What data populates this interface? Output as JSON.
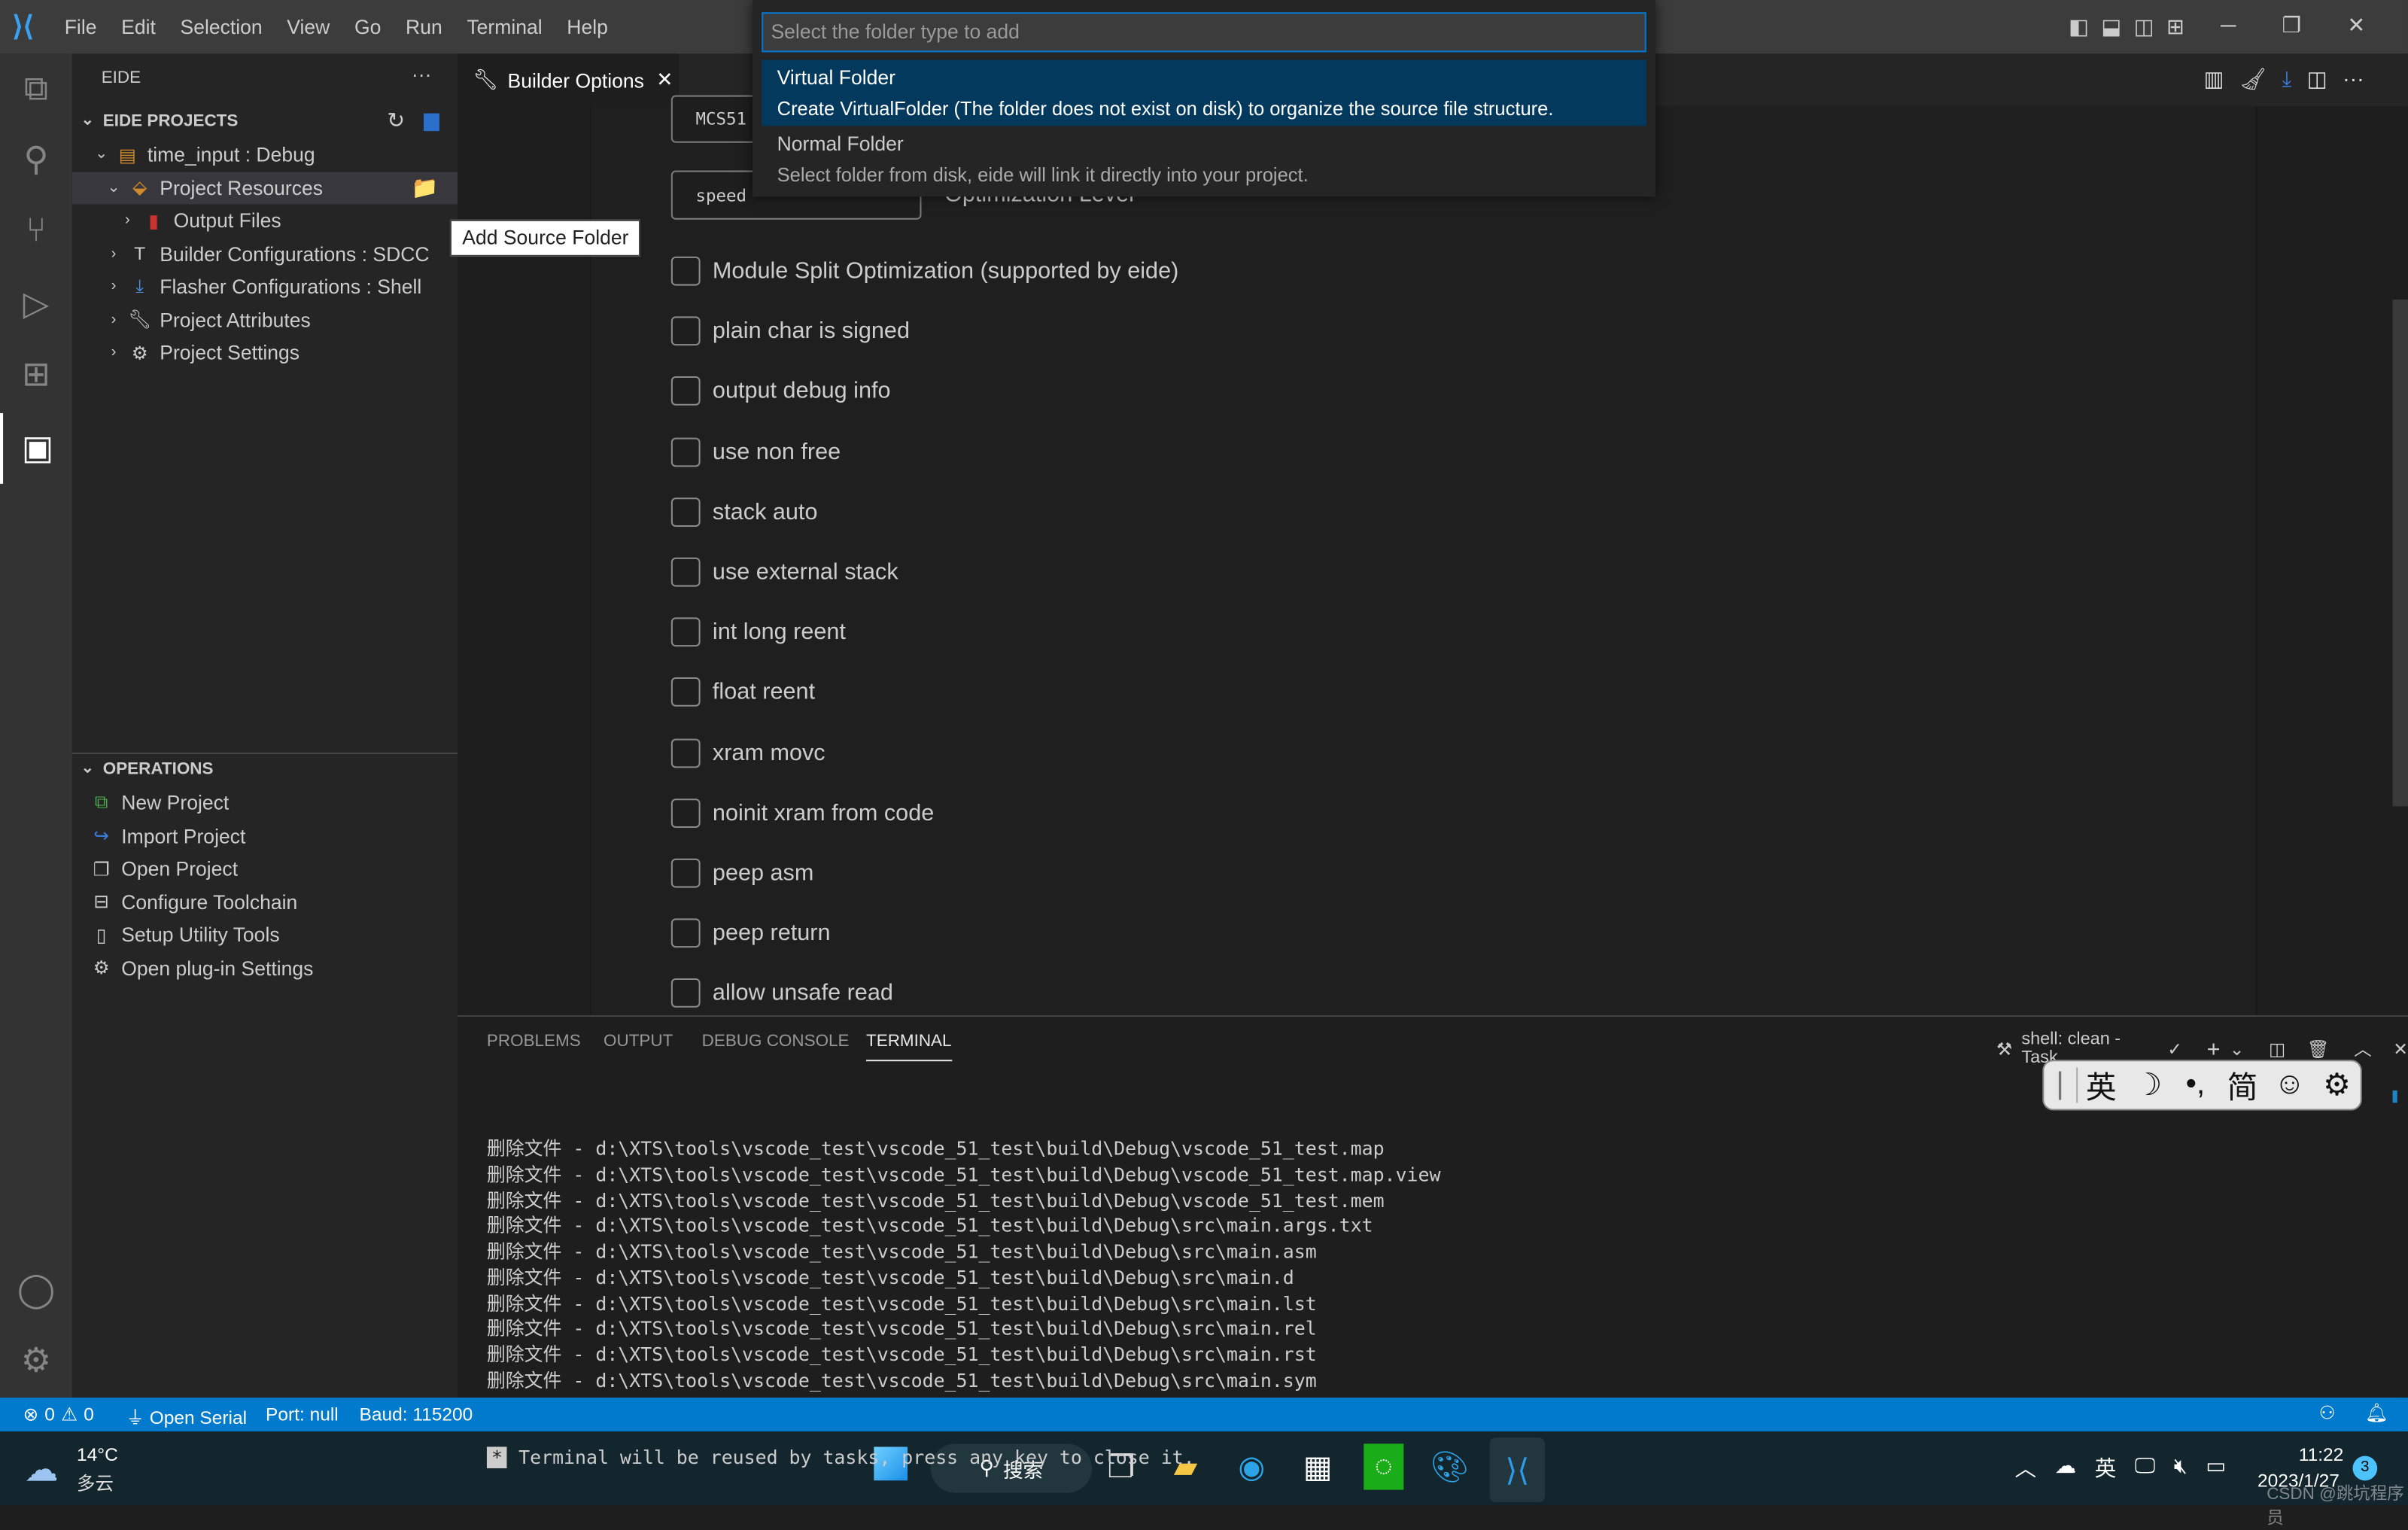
{
  "menu": [
    "File",
    "Edit",
    "Selection",
    "View",
    "Go",
    "Run",
    "Terminal",
    "Help"
  ],
  "sidebar": {
    "title": "EIDE",
    "more": "···",
    "projects_header": "EIDE PROJECTS",
    "tree": [
      {
        "label": "time_input : Debug",
        "icon": "project-icon"
      },
      {
        "label": "Project Resources",
        "icon": "resources-icon"
      },
      {
        "label": "Output Files",
        "icon": "binary-file-icon"
      },
      {
        "label": "Builder Configurations : SDCC",
        "icon": "hammer-icon"
      },
      {
        "label": "Flasher Configurations : Shell",
        "icon": "download-icon"
      },
      {
        "label": "Project Attributes",
        "icon": "wrench-icon"
      },
      {
        "label": "Project Settings",
        "icon": "gear-icon"
      }
    ],
    "operations_header": "OPERATIONS",
    "operations": [
      "New Project",
      "Import Project",
      "Open Project",
      "Configure Toolchain",
      "Setup Utility Tools",
      "Open plug-in Settings"
    ]
  },
  "tooltip": "Add Source Folder",
  "editor": {
    "tab_label": "Builder Options",
    "cpu_select": "MCS51",
    "opt_select": "speed",
    "opt_label": "Optimization Level",
    "checkboxes": [
      {
        "label": "Module Split Optimization (supported by eide)",
        "checked": false
      },
      {
        "label": "plain char is signed",
        "checked": false
      },
      {
        "label": "output debug info",
        "checked": false
      },
      {
        "label": "use non free",
        "checked": false
      },
      {
        "label": "stack auto",
        "checked": false
      },
      {
        "label": "use external stack",
        "checked": false
      },
      {
        "label": "int long reent",
        "checked": false
      },
      {
        "label": "float reent",
        "checked": false
      },
      {
        "label": "xram movc",
        "checked": false
      },
      {
        "label": "noinit xram from code",
        "checked": false
      },
      {
        "label": "peep asm",
        "checked": false
      },
      {
        "label": "peep return",
        "checked": false
      },
      {
        "label": "allow unsafe read",
        "checked": false
      }
    ]
  },
  "quickpick": {
    "placeholder": "Select the folder type to add",
    "items": [
      {
        "label": "Virtual Folder",
        "detail": "Create VirtualFolder (The folder does not exist on disk) to organize the source file structure."
      },
      {
        "label": "Normal Folder",
        "detail": "Select folder from disk, eide will link it directly into your project."
      }
    ]
  },
  "panel": {
    "tabs": [
      "PROBLEMS",
      "OUTPUT",
      "DEBUG CONSOLE",
      "TERMINAL"
    ],
    "active_tab": "TERMINAL",
    "terminal_name": "shell: clean - Task",
    "lines": [
      "删除文件 - d:\\XTS\\tools\\vscode_test\\vscode_51_test\\build\\Debug\\vscode_51_test.map",
      "删除文件 - d:\\XTS\\tools\\vscode_test\\vscode_51_test\\build\\Debug\\vscode_51_test.map.view",
      "删除文件 - d:\\XTS\\tools\\vscode_test\\vscode_51_test\\build\\Debug\\vscode_51_test.mem",
      "删除文件 - d:\\XTS\\tools\\vscode_test\\vscode_51_test\\build\\Debug\\src\\main.args.txt",
      "删除文件 - d:\\XTS\\tools\\vscode_test\\vscode_51_test\\build\\Debug\\src\\main.asm",
      "删除文件 - d:\\XTS\\tools\\vscode_test\\vscode_51_test\\build\\Debug\\src\\main.d",
      "删除文件 - d:\\XTS\\tools\\vscode_test\\vscode_51_test\\build\\Debug\\src\\main.lst",
      "删除文件 - d:\\XTS\\tools\\vscode_test\\vscode_51_test\\build\\Debug\\src\\main.rel",
      "删除文件 - d:\\XTS\\tools\\vscode_test\\vscode_51_test\\build\\Debug\\src\\main.rst",
      "删除文件 - d:\\XTS\\tools\\vscode_test\\vscode_51_test\\build\\Debug\\src\\main.sym"
    ],
    "star": "*",
    "last_line": "Terminal will be reused by tasks, press any key to close it."
  },
  "ime": [
    "英",
    "☽",
    "•,",
    "简",
    "☺",
    "⚙"
  ],
  "status": {
    "errors": "0",
    "warnings": "0",
    "serial": "Open Serial",
    "port": "Port: null",
    "baud": "Baud: 115200"
  },
  "taskbar": {
    "weather_temp": "14°C",
    "weather_desc": "多云",
    "search": "搜索",
    "tray_lang": "英",
    "time": "11:22",
    "date": "2023/1/27",
    "notifications": "3",
    "watermark": "CSDN @跳坑程序员"
  },
  "colors": {
    "accent": "#007acc",
    "selection": "#04395e"
  }
}
